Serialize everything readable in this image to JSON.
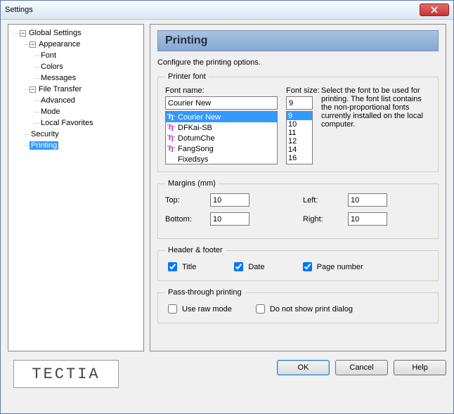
{
  "window": {
    "title": "Settings"
  },
  "tree": {
    "root": "Global Settings",
    "appearance": "Appearance",
    "font": "Font",
    "colors": "Colors",
    "messages": "Messages",
    "file_transfer": "File Transfer",
    "advanced": "Advanced",
    "mode": "Mode",
    "local_favorites": "Local Favorites",
    "security": "Security",
    "printing": "Printing"
  },
  "panel": {
    "title": "Printing",
    "desc": "Configure the printing options.",
    "printer_font_legend": "Printer font",
    "font_name_label": "Font name:",
    "font_size_label": "Font size:",
    "font_name_value": "Courier New",
    "font_size_value": "9",
    "font_list": [
      "Courier New",
      "DFKai-SB",
      "DotumChe",
      "FangSong",
      "Fixedsys"
    ],
    "size_list": [
      "9",
      "10",
      "11",
      "12",
      "14",
      "16"
    ],
    "help_text": "Select the font to be used for printing. The font list contains the non-proportional fonts currently installed on the local computer.",
    "margins_legend": "Margins (mm)",
    "margin_top_label": "Top:",
    "margin_bottom_label": "Bottom:",
    "margin_left_label": "Left:",
    "margin_right_label": "Right:",
    "margin_top": "10",
    "margin_bottom": "10",
    "margin_left": "10",
    "margin_right": "10",
    "header_legend": "Header & footer",
    "chk_title": "Title",
    "chk_date": "Date",
    "chk_page": "Page number",
    "pass_legend": "Pass-through printing",
    "chk_raw": "Use raw mode",
    "chk_nodlg": "Do not show print dialog"
  },
  "logo": "TECTIA",
  "buttons": {
    "ok": "OK",
    "cancel": "Cancel",
    "help": "Help"
  }
}
